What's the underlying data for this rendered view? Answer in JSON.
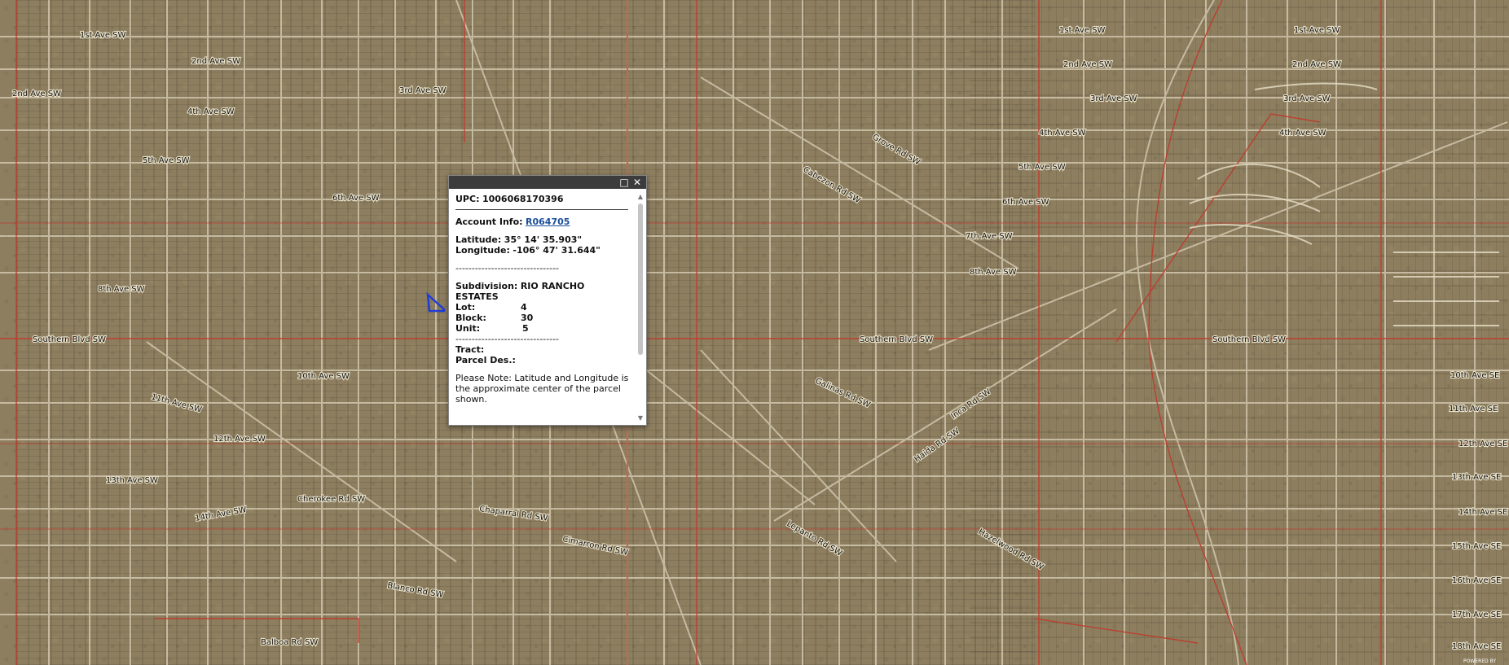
{
  "popup": {
    "maximize_icon": "maximize-icon",
    "close_icon": "close-icon",
    "upc_label": "UPC:",
    "upc_value": "1006068170396",
    "account_label": "Account Info:",
    "account_link": "R064705",
    "latitude_label": "Latitude:",
    "latitude_value": "35° 14' 35.903\"",
    "longitude_label": "Longitude:",
    "longitude_value": "-106° 47' 31.644\"",
    "dashes": "--------------------------------",
    "subdivision_label": "Subdivision:",
    "subdivision_value": "RIO RANCHO",
    "subdivision_value2": "ESTATES",
    "lot_label": "Lot:",
    "lot_value": "4",
    "block_label": "Block:",
    "block_value": "30",
    "unit_label": "Unit:",
    "unit_value": "5",
    "tract_label": "Tract:",
    "parcel_label": "Parcel Des.:",
    "note": "Please Note: Latitude and Longitude is the approximate center of the parcel shown."
  },
  "map": {
    "streets_h": [
      "1st Ave SW",
      "2nd Ave SW",
      "2nd Ave SW",
      "3rd Ave SW",
      "4th Ave SW",
      "5th Ave SW",
      "6th Ave SW",
      "8th Ave SW",
      "Southern Blvd SW",
      "10th Ave SW",
      "11th Ave SW",
      "12th Ave SW",
      "13th Ave SW",
      "14th Ave SW",
      "Cherokee Rd SW",
      "Blanco Rd SW",
      "Balboa Rd SW",
      "1st Ave SW",
      "2nd Ave SW",
      "3rd Ave SW",
      "4th Ave SW",
      "5th Ave SW",
      "6th Ave SW",
      "7th Ave SW",
      "8th Ave SW",
      "Southern Blvd SW",
      "Southern Blvd SW",
      "1st Ave SW",
      "2nd Ave SW",
      "3rd Ave SW",
      "4th Ave SW",
      "10th Ave SE",
      "11th Ave SE",
      "12th Ave SE",
      "13th Ave SE",
      "14th Ave SE",
      "15th Ave SE",
      "16th Ave SE",
      "17th Ave SE",
      "18th Ave SE",
      "Grove Rd SW",
      "Cabezon Rd SW",
      "Galinas Rd SW",
      "Inca Rd SW",
      "Haida Rd SW",
      "Lepanto Rd SW",
      "Hazelwood Rd SW",
      "Chaparral Rd SW",
      "Cimarron Rd SW"
    ],
    "accent_road": "#c0392b",
    "selected_parcel": "#1e3cd8",
    "powered": "POWERED BY"
  }
}
